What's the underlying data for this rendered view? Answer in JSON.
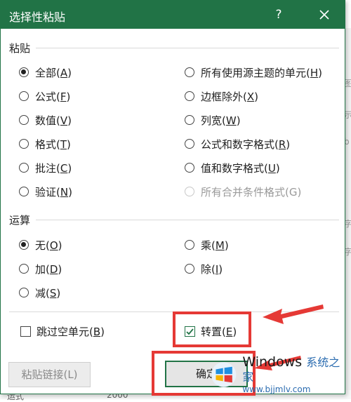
{
  "dialog": {
    "title": "选择性粘贴",
    "help": "?",
    "close": "✕"
  },
  "paste": {
    "label": "粘贴",
    "left": [
      {
        "text": "全部(",
        "key": "A",
        "tail": ")",
        "checked": true
      },
      {
        "text": "公式(",
        "key": "F",
        "tail": ")",
        "checked": false
      },
      {
        "text": "数值(",
        "key": "V",
        "tail": ")",
        "checked": false
      },
      {
        "text": "格式(",
        "key": "T",
        "tail": ")",
        "checked": false
      },
      {
        "text": "批注(",
        "key": "C",
        "tail": ")",
        "checked": false
      },
      {
        "text": "验证(",
        "key": "N",
        "tail": ")",
        "checked": false
      }
    ],
    "right": [
      {
        "text": "所有使用源主题的单元(",
        "key": "H",
        "tail": ")",
        "checked": false
      },
      {
        "text": "边框除外(",
        "key": "X",
        "tail": ")",
        "checked": false
      },
      {
        "text": "列宽(",
        "key": "W",
        "tail": ")",
        "checked": false
      },
      {
        "text": "公式和数字格式(",
        "key": "R",
        "tail": ")",
        "checked": false
      },
      {
        "text": "值和数字格式(",
        "key": "U",
        "tail": ")",
        "checked": false
      },
      {
        "text": "所有合并条件格式(G)",
        "key": "",
        "tail": "",
        "checked": false,
        "disabled": true
      }
    ]
  },
  "operation": {
    "label": "运算",
    "left": [
      {
        "text": "无(",
        "key": "O",
        "tail": ")",
        "checked": true
      },
      {
        "text": "加(",
        "key": "D",
        "tail": ")",
        "checked": false
      },
      {
        "text": "减(",
        "key": "S",
        "tail": ")",
        "checked": false
      }
    ],
    "right": [
      {
        "text": "乘(",
        "key": "M",
        "tail": ")",
        "checked": false
      },
      {
        "text": "除(",
        "key": "I",
        "tail": ")",
        "checked": false
      }
    ]
  },
  "checks": {
    "skip_blanks": {
      "text": "跳过空单元(",
      "key": "B",
      "tail": ")",
      "checked": false
    },
    "transpose": {
      "text": "转置(",
      "key": "E",
      "tail": ")",
      "checked": true
    }
  },
  "buttons": {
    "paste_link": "粘贴链接(L)",
    "ok": "确定"
  },
  "watermark": {
    "title": "Windows",
    "title_cn": "系统之家",
    "url": "www.bjjmlv.com"
  },
  "background": {
    "right_chars": [
      "图",
      "示",
      "b",
      "字",
      "字"
    ],
    "bottom_left": "运式",
    "bottom_mid": "2000"
  },
  "colors": {
    "accent": "#217346",
    "highlight": "#e53935"
  }
}
